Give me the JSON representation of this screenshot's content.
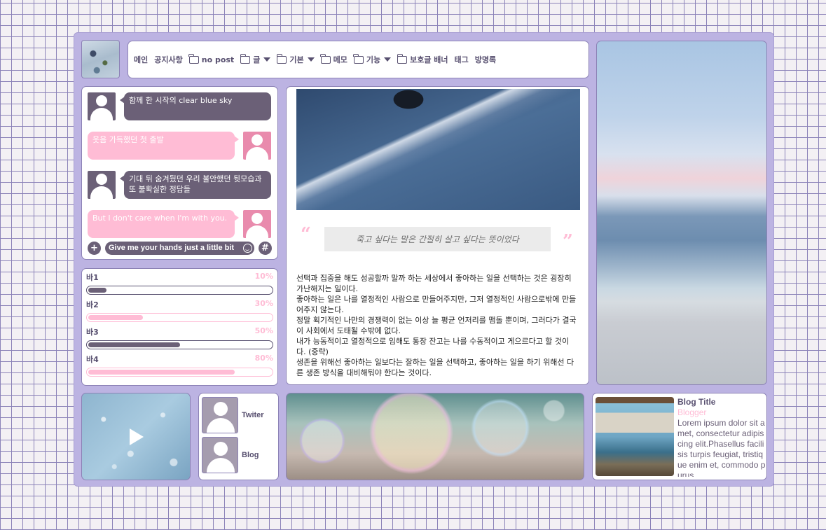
{
  "nav": {
    "items": [
      {
        "label": "메인",
        "folder": false,
        "dropdown": false
      },
      {
        "label": "공지사항",
        "folder": false,
        "dropdown": false
      },
      {
        "label": "no post",
        "folder": true,
        "dropdown": false
      },
      {
        "label": "글",
        "folder": true,
        "dropdown": true
      },
      {
        "label": "기본",
        "folder": true,
        "dropdown": true
      },
      {
        "label": "메모",
        "folder": true,
        "dropdown": false
      },
      {
        "label": "기능",
        "folder": true,
        "dropdown": true
      },
      {
        "label": "보호글 배너",
        "folder": true,
        "dropdown": false
      },
      {
        "label": "태그",
        "folder": false,
        "dropdown": false
      },
      {
        "label": "방명록",
        "folder": false,
        "dropdown": false
      }
    ]
  },
  "chat": {
    "messages": [
      {
        "side": "left",
        "text": "함께 한 시작의 clear blue sky"
      },
      {
        "side": "right",
        "text": "웃음 가득했던 첫 출발"
      },
      {
        "side": "left",
        "text": "기대 뒤 숨겨뒀던 우리 불안했던 뒷모습과 또 불확실한 정답들"
      },
      {
        "side": "right",
        "text": "But I don't care when I'm with you."
      }
    ],
    "input_value": "Give me your hands just a little bit",
    "plus_icon": "+",
    "hash_icon": "#"
  },
  "progress": {
    "bars": [
      {
        "label": "바1",
        "percent_text": "10%",
        "value": 0.1,
        "style": "dark"
      },
      {
        "label": "바2",
        "percent_text": "30%",
        "value": 0.3,
        "style": "pink"
      },
      {
        "label": "바3",
        "percent_text": "50%",
        "value": 0.5,
        "style": "dark"
      },
      {
        "label": "바4",
        "percent_text": "80%",
        "value": 0.8,
        "style": "pink"
      }
    ]
  },
  "post": {
    "quote_open": "“",
    "quote_close": "”",
    "quote": "죽고 싶다는 말은 간절히 살고 싶다는 뜻이었다",
    "paragraphs": [
      "선택과 집중을 해도 성공할까 말까 하는 세상에서 좋아하는 일을 선택하는 것은 굉장히 가난해지는 일이다.",
      "좋아하는 일은 나를 열정적인 사람으로 만들어주지만, 그저 열정적인 사람으로밖에 만들어주지 않는다.",
      "정말 획기적인 나만의 경쟁력이 없는 이상 늘 평균 언저리를 맴돌 뿐이며, 그러다가 결국 이 사회에서 도태될 수밖에 없다.",
      "내가 능동적이고 열정적으로 임해도 통장 잔고는 나를 수동적이고 게으르다고 할 것이다. (중략)",
      "생존을 위해선 좋아하는 일보다는 잘하는 일을 선택하고, 좋아하는 일을 하기 위해선 다른 생존 방식을 대비해둬야 한다는 것이다."
    ]
  },
  "links": [
    {
      "label": "Twiter"
    },
    {
      "label": "Blog"
    }
  ],
  "blog_card": {
    "title": "Blog Title",
    "author": "Blogger",
    "body": "Lorem ipsum dolor sit amet, consectetur adipiscing elit.Phasellus facilisis turpis feugiat, tristique enim et, commodo purus."
  },
  "colors": {
    "accent_dark": "#6b6077",
    "accent_pink": "#ffbcd5",
    "frame": "#bcb3e2"
  }
}
